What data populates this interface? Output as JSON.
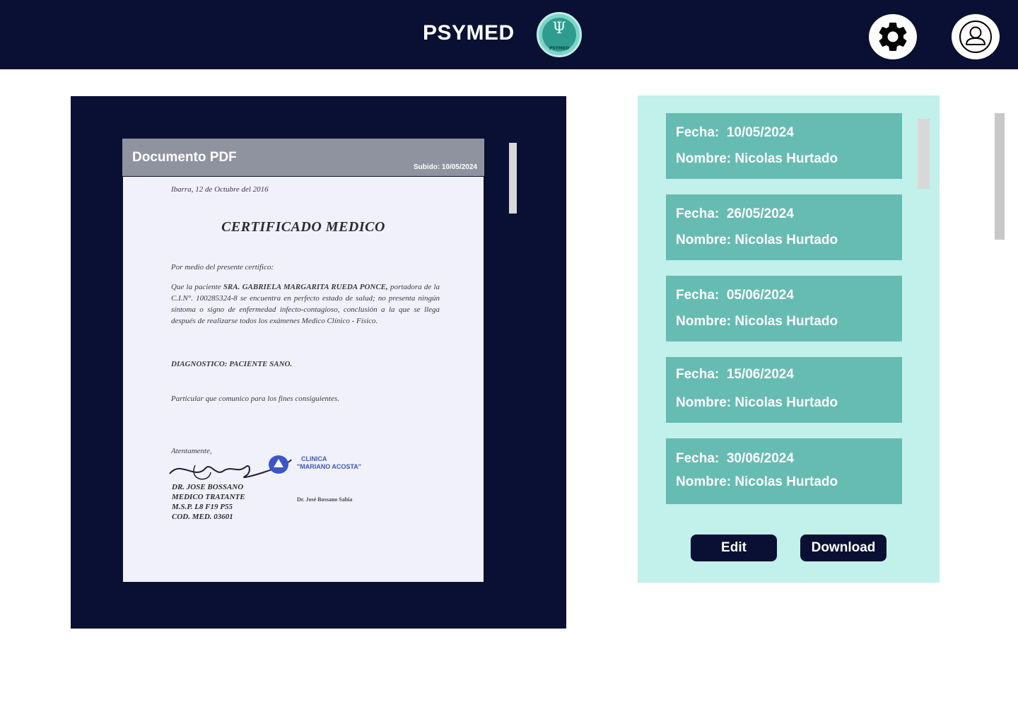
{
  "header": {
    "app_title": "PSYMED",
    "logo": {
      "symbol": "Ψ",
      "caption": "PSYMED"
    },
    "settings_icon": "gear-icon",
    "profile_icon": "user-icon"
  },
  "viewer": {
    "title": "Documento PDF",
    "uploaded": "Subido: 10/05/2024",
    "document": {
      "place_date": "Ibarra, 12  de Octubre  del 2016",
      "heading": "CERTIFICADO MEDICO",
      "intro": "Por medio del presente certifico:",
      "body_prefix": "Que la paciente ",
      "patient": "SRA. GABRIELA MARGARITA RUEDA PONCE,",
      "body_rest": " portadora de la C.I.N°. 100285324-8 se encuentra en perfecto estado de salud; no presenta ningún síntoma o signo de enfermedad infecto-contagioso, conclusión a la que se llega después de realizarse todos los exámenes Medico Clínico - Físico.",
      "diagnosis": "DIAGNOSTICO: PACIENTE SANO.",
      "closing": "Particular que comunico para los fines consiguientes.",
      "regards": "Atentamente,",
      "doctor": [
        "DR. JOSE BOSSANO",
        "MEDICO TRATANTE",
        "M.S.P. L8 F19 P55",
        "COD. MED. 03601"
      ],
      "clinic_stamp": [
        "CLINICA",
        "\"MARIANO ACOSTA\""
      ],
      "doctor_stamp": "Dr. José Bossano Sabia"
    }
  },
  "records": [
    {
      "fecha_label": "Fecha:",
      "fecha": "10/05/2024",
      "nombre_label": "Nombre:",
      "nombre": "Nicolas Hurtado"
    },
    {
      "fecha_label": "Fecha:",
      "fecha": "26/05/2024",
      "nombre_label": "Nombre:",
      "nombre": "Nicolas Hurtado"
    },
    {
      "fecha_label": "Fecha:",
      "fecha": "05/06/2024",
      "nombre_label": "Nombre:",
      "nombre": "Nicolas Hurtado"
    },
    {
      "fecha_label": "Fecha:",
      "fecha": "15/06/2024",
      "nombre_label": "Nombre:",
      "nombre": "Nicolas Hurtado"
    },
    {
      "fecha_label": "Fecha:",
      "fecha": "30/06/2024",
      "nombre_label": "Nombre:",
      "nombre": "Nicolas Hurtado"
    }
  ],
  "actions": {
    "edit": "Edit",
    "download": "Download"
  },
  "colors": {
    "navy": "#0a1033",
    "panel": "#c2f0ea",
    "card": "#66bcb3",
    "pdf_header": "#8f939f"
  }
}
